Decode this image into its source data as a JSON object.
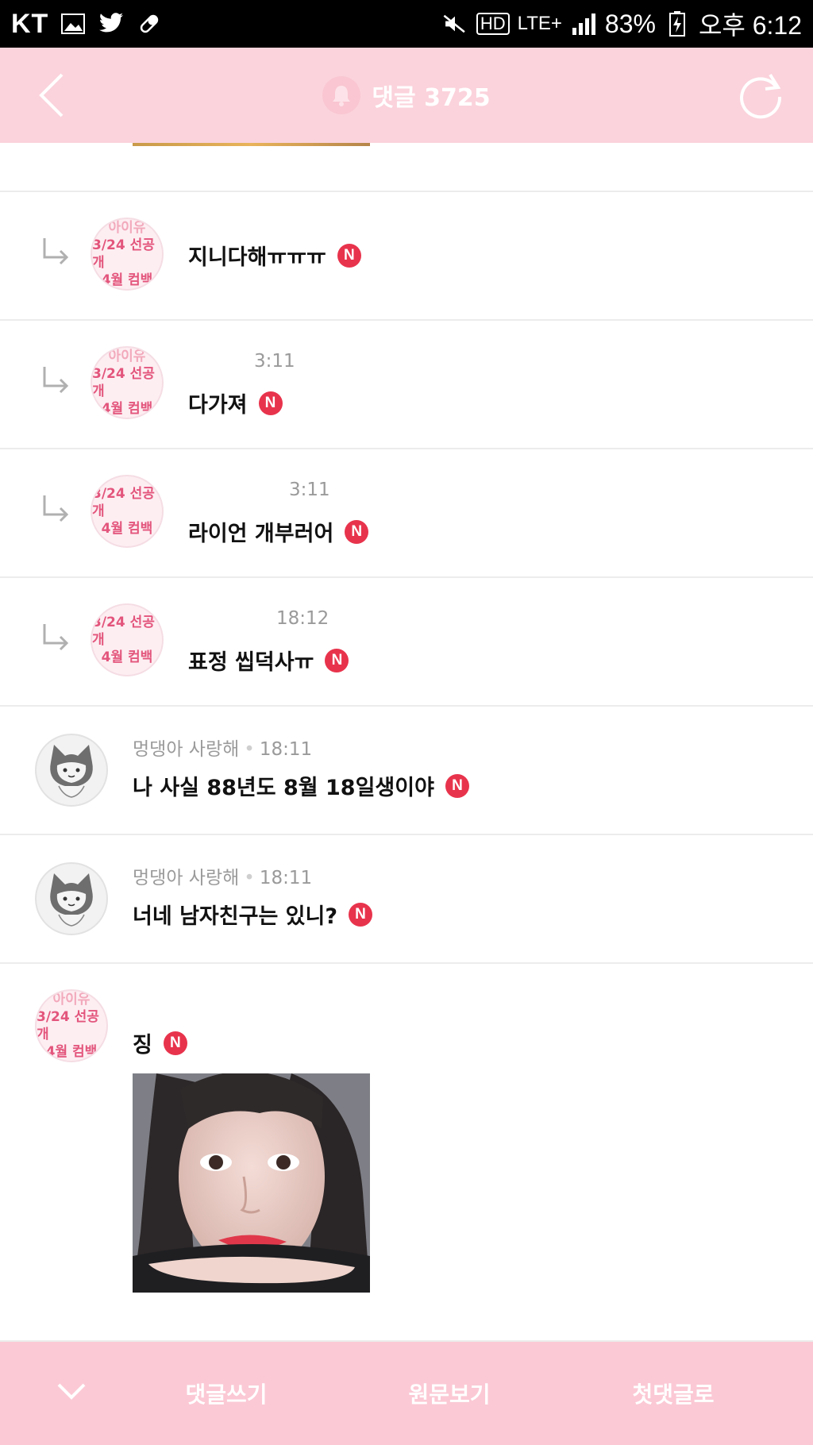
{
  "status_bar": {
    "carrier": "KT",
    "network_hd": "HD",
    "network": "LTE+",
    "battery": "83%",
    "time": "오후 6:12"
  },
  "header": {
    "title": "댓글 3725",
    "icons": [
      "back-icon",
      "bell-icon",
      "refresh-icon"
    ]
  },
  "comments": [
    {
      "type": "reply",
      "avatar_lines": [
        "아이유",
        "3/24 선공개",
        "4월 컴백"
      ],
      "meta": "",
      "text": "지니다해ㅠㅠㅠ",
      "badge": "N"
    },
    {
      "type": "reply",
      "avatar_lines": [
        "아이유",
        "3/24 선공개",
        "4월 컴백"
      ],
      "meta": "3:11",
      "text": "다가져",
      "badge": "N"
    },
    {
      "type": "reply",
      "avatar_lines": [
        "",
        "3/24 선공개",
        "4월 컴백"
      ],
      "meta": "3:11",
      "text": "라이언 개부러어",
      "badge": "N"
    },
    {
      "type": "reply",
      "avatar_lines": [
        "",
        "3/24 선공개",
        "4월 컴백"
      ],
      "meta": "18:12",
      "text": "표정 씹덕사ㅠ",
      "badge": "N"
    },
    {
      "type": "comment",
      "nickname": "멍댕아 사랑해",
      "time": "18:11",
      "text": "나 사실 88년도 8월 18일생이야",
      "badge": "N"
    },
    {
      "type": "comment",
      "nickname": "멍댕아 사랑해",
      "time": "18:11",
      "text": "너네 남자친구는 있니?",
      "badge": "N"
    },
    {
      "type": "comment",
      "avatar_lines": [
        "아이유",
        "3/24 선공개",
        "4월 컴백"
      ],
      "nickname": "",
      "text": "징",
      "badge": "N"
    }
  ],
  "bottom_bar": {
    "write_comment": "댓글쓰기",
    "view_original": "원문보기",
    "first_comment": "첫댓글로"
  },
  "colors": {
    "header_bg": "#fbd3dc",
    "bottom_bg": "#fbc9d5",
    "badge": "#e8334c",
    "accent_pink": "#e3557c"
  }
}
